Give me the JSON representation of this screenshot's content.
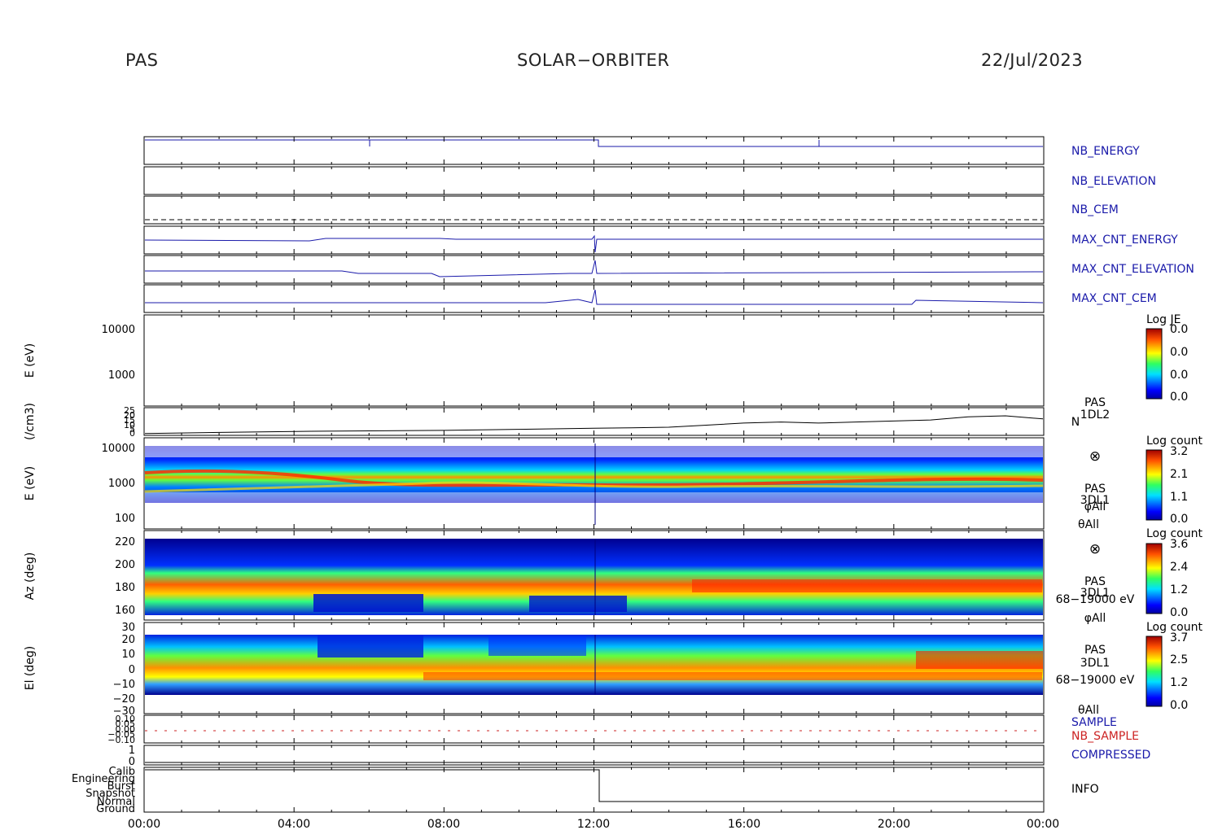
{
  "header": {
    "left": "PAS",
    "center": "SOLAR−ORBITER",
    "right": "22/Jul/2023"
  },
  "x_axis": {
    "ticks": [
      "00:00",
      "04:00",
      "08:00",
      "12:00",
      "16:00",
      "20:00",
      "00:00"
    ]
  },
  "panel_labels": {
    "nb_energy": "NB_ENERGY",
    "nb_elevation": "NB_ELEVATION",
    "nb_cem": "NB_CEM",
    "max_cnt_energy": "MAX_CNT_ENERGY",
    "max_cnt_elevation": "MAX_CNT_ELEVATION",
    "max_cnt_cem": "MAX_CNT_CEM",
    "sample": "SAMPLE",
    "nb_sample": "NB_SAMPLE",
    "compressed": "COMPRESSED",
    "info": "INFO"
  },
  "colors": {
    "series_blue": "#1a1aaa",
    "label_blue": "#1a1aaa",
    "nb_sample_red": "#cc2222",
    "black": "#000000"
  },
  "spec1": {
    "ylabel": "E (eV)",
    "yticks": [
      "10000",
      "1000"
    ],
    "cbar": {
      "title": "Log JE",
      "ticks": [
        "0.0",
        "0.0",
        "0.0",
        "0.0"
      ]
    }
  },
  "density": {
    "ylabel": "(/cm3)",
    "yticks": [
      "25",
      "20",
      "15",
      "10",
      "5",
      "0"
    ],
    "right_label_1": "PAS",
    "right_label_2": "1DL2",
    "right_label_3": "N"
  },
  "spec2": {
    "ylabel": "E (eV)",
    "yticks": [
      "10000",
      "1000",
      "100"
    ],
    "cbar": {
      "title": "Log count",
      "ticks": [
        "3.2",
        "2.1",
        "1.1",
        "0.0"
      ]
    },
    "right_label_1": "⊗",
    "right_label_2": "PAS",
    "right_label_3": "3DL1",
    "right_label_4": "φAll",
    "right_label_5": "θAll"
  },
  "spec3": {
    "ylabel": "Az (deg)",
    "yticks": [
      "220",
      "200",
      "180",
      "160"
    ],
    "cbar": {
      "title": "Log count",
      "ticks": [
        "3.6",
        "2.4",
        "1.2",
        "0.0"
      ]
    },
    "right_label_1": "⊗",
    "right_label_2": "PAS",
    "right_label_3": "3DL1",
    "right_label_4": "68−19000 eV",
    "right_label_5": "φAll"
  },
  "spec4": {
    "ylabel": "El (deg)",
    "yticks": [
      "30",
      "20",
      "10",
      "0",
      "−10",
      "−20",
      "−30"
    ],
    "cbar": {
      "title": "Log count",
      "ticks": [
        "3.7",
        "2.5",
        "1.2",
        "0.0"
      ]
    },
    "right_label_1": "PAS",
    "right_label_2": "3DL1",
    "right_label_3": "68−19000 eV",
    "right_label_4": "θAll"
  },
  "info": {
    "yticks": [
      "Calib",
      "Engineering",
      "Burst",
      "Snapshot",
      "Normal",
      "Ground"
    ]
  },
  "compressed": {
    "yticks": [
      "1",
      "0"
    ]
  },
  "sample": {
    "yticks": [
      "0.10",
      "0.05",
      "0.00",
      "−0.05",
      "−0.10"
    ]
  },
  "chart_data": {
    "type": "heatmap",
    "title": "",
    "x_range": [
      "00:00",
      "24:00"
    ],
    "energy_spectrogram": {
      "y_scale": "log",
      "ylim": [
        100,
        10000
      ],
      "peak_energy_eV_by_hour": [
        [
          0,
          1150
        ],
        [
          2,
          1250
        ],
        [
          4,
          1200
        ],
        [
          6,
          1100
        ],
        [
          8,
          1100
        ],
        [
          10,
          1150
        ],
        [
          11,
          1200
        ],
        [
          12,
          1000
        ],
        [
          14,
          1000
        ],
        [
          16,
          1050
        ],
        [
          18,
          1050
        ],
        [
          20,
          1050
        ],
        [
          22,
          1050
        ],
        [
          24,
          1000
        ]
      ]
    },
    "density_series": {
      "ylim": [
        0,
        25
      ],
      "hours": [
        0,
        2,
        4,
        6,
        8,
        10,
        12,
        13,
        14,
        15,
        16,
        17,
        18,
        19,
        20,
        21,
        22,
        23,
        24
      ],
      "values": [
        1,
        2,
        3,
        3.5,
        4,
        5,
        6,
        6.5,
        7,
        9,
        11,
        12,
        11,
        12,
        13,
        14,
        17,
        18,
        15
      ]
    },
    "azimuth_peak_deg_by_hour": [
      [
        0,
        178
      ],
      [
        4,
        178
      ],
      [
        8,
        180
      ],
      [
        12,
        180
      ],
      [
        16,
        180
      ],
      [
        20,
        178
      ],
      [
        24,
        180
      ]
    ],
    "elevation_peak_deg_by_hour": [
      [
        0,
        8
      ],
      [
        4,
        6
      ],
      [
        8,
        -4
      ],
      [
        12,
        -2
      ],
      [
        16,
        0
      ],
      [
        20,
        2
      ],
      [
        24,
        6
      ]
    ]
  }
}
